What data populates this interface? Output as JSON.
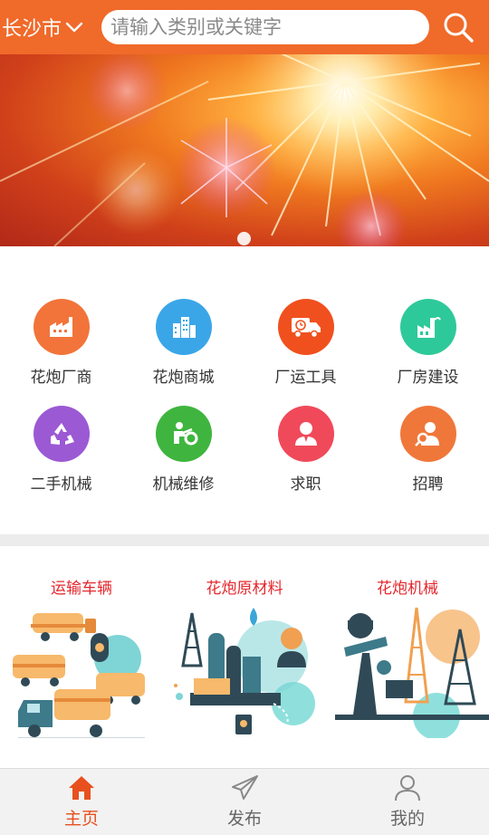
{
  "header": {
    "city": "长沙市",
    "search_placeholder": "请输入类别或关键字"
  },
  "banner": {
    "dots": 1,
    "active_dot": 1
  },
  "categories": [
    {
      "label": "花炮厂商",
      "icon": "factory-icon",
      "color": "#f2743a"
    },
    {
      "label": "花炮商城",
      "icon": "buildings-icon",
      "color": "#3aa6e8"
    },
    {
      "label": "厂运工具",
      "icon": "truck-icon",
      "color": "#f0501e"
    },
    {
      "label": "厂房建设",
      "icon": "plant-icon",
      "color": "#2ec99a"
    },
    {
      "label": "二手机械",
      "icon": "recycle-icon",
      "color": "#9b59d4"
    },
    {
      "label": "机械维修",
      "icon": "repair-icon",
      "color": "#3fb53f"
    },
    {
      "label": "求职",
      "icon": "person-icon",
      "color": "#f04a5a"
    },
    {
      "label": "招聘",
      "icon": "recruit-icon",
      "color": "#f0773a"
    }
  ],
  "features": [
    {
      "title": "运输车辆"
    },
    {
      "title": "花炮原材料"
    },
    {
      "title": "花炮机械"
    }
  ],
  "bottom_nav": [
    {
      "label": "主页",
      "icon": "home-icon",
      "active": true
    },
    {
      "label": "发布",
      "icon": "send-icon",
      "active": false
    },
    {
      "label": "我的",
      "icon": "profile-icon",
      "active": false
    }
  ],
  "colors": {
    "brand": "#f06a2a",
    "feature_title": "#e5272d",
    "nav_active": "#e8501e"
  }
}
